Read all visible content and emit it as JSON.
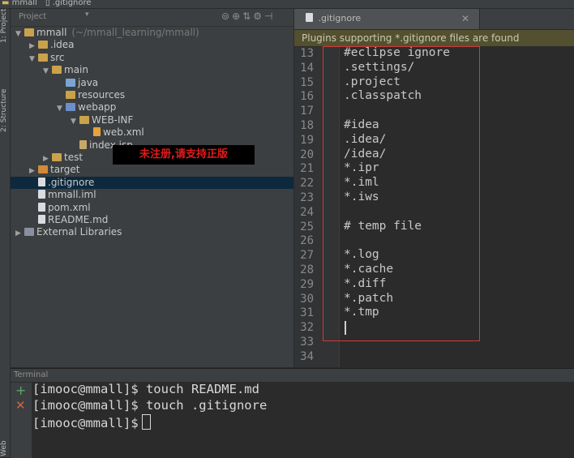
{
  "breadcrumb": {
    "project": "mmall",
    "file": ".gitignore"
  },
  "toolstrip": {
    "project_label": "1: Project",
    "structure_label": "2: Structure",
    "bottom_label": "Web"
  },
  "project_panel": {
    "title": "Project",
    "tree": [
      {
        "label": "mmall",
        "suffix": "(~/mmall_learning/mmall)",
        "indent": 0,
        "arrow": "▼",
        "icon": "folder"
      },
      {
        "label": ".idea",
        "indent": 1,
        "arrow": "▶",
        "icon": "folder"
      },
      {
        "label": "src",
        "indent": 1,
        "arrow": "▼",
        "icon": "folder"
      },
      {
        "label": "main",
        "indent": 2,
        "arrow": "▼",
        "icon": "folder"
      },
      {
        "label": "java",
        "indent": 3,
        "arrow": "",
        "icon": "folder-src"
      },
      {
        "label": "resources",
        "indent": 3,
        "arrow": "",
        "icon": "folder-res"
      },
      {
        "label": "webapp",
        "indent": 3,
        "arrow": "▼",
        "icon": "folder-web"
      },
      {
        "label": "WEB-INF",
        "indent": 4,
        "arrow": "▼",
        "icon": "folder"
      },
      {
        "label": "web.xml",
        "indent": 5,
        "arrow": "",
        "icon": "xml"
      },
      {
        "label": "index.jsp",
        "indent": 4,
        "arrow": "",
        "icon": "jsp"
      },
      {
        "label": "test",
        "indent": 2,
        "arrow": "▶",
        "icon": "folder"
      },
      {
        "label": "target",
        "indent": 1,
        "arrow": "▶",
        "icon": "folder-orange"
      },
      {
        "label": ".gitignore",
        "indent": 1,
        "arrow": "",
        "icon": "file",
        "selected": true
      },
      {
        "label": "mmall.iml",
        "indent": 1,
        "arrow": "",
        "icon": "file"
      },
      {
        "label": "pom.xml",
        "indent": 1,
        "arrow": "",
        "icon": "file"
      },
      {
        "label": "README.md",
        "indent": 1,
        "arrow": "",
        "icon": "file"
      },
      {
        "label": "External Libraries",
        "indent": 0,
        "arrow": "▶",
        "icon": "lib"
      }
    ]
  },
  "watermark": "未注册,请支持正版",
  "editor": {
    "tab": ".gitignore",
    "notice": "Plugins supporting *.gitignore files are found",
    "lines": [
      {
        "num": "13",
        "text": "#eclipse ignore"
      },
      {
        "num": "14",
        "text": ".settings/"
      },
      {
        "num": "15",
        "text": ".project"
      },
      {
        "num": "16",
        "text": ".classpatch"
      },
      {
        "num": "17",
        "text": ""
      },
      {
        "num": "18",
        "text": "#idea"
      },
      {
        "num": "19",
        "text": ".idea/"
      },
      {
        "num": "20",
        "text": "/idea/"
      },
      {
        "num": "21",
        "text": "*.ipr"
      },
      {
        "num": "22",
        "text": "*.iml"
      },
      {
        "num": "23",
        "text": "*.iws"
      },
      {
        "num": "24",
        "text": ""
      },
      {
        "num": "25",
        "text": "# temp file"
      },
      {
        "num": "26",
        "text": ""
      },
      {
        "num": "27",
        "text": "*.log"
      },
      {
        "num": "28",
        "text": "*.cache"
      },
      {
        "num": "29",
        "text": "*.diff"
      },
      {
        "num": "30",
        "text": "*.patch"
      },
      {
        "num": "31",
        "text": "*.tmp"
      },
      {
        "num": "32",
        "text": ""
      },
      {
        "num": "33",
        "text": ""
      },
      {
        "num": "34",
        "text": ""
      }
    ]
  },
  "terminal": {
    "title": "Terminal",
    "lines": [
      "[imooc@mmall]$ touch README.md",
      "[imooc@mmall]$ touch .gitignore",
      "[imooc@mmall]$"
    ]
  },
  "colors": {
    "selection": "#0d293e",
    "notice_bg": "#53502f",
    "highlight_box": "#d23a3a"
  }
}
